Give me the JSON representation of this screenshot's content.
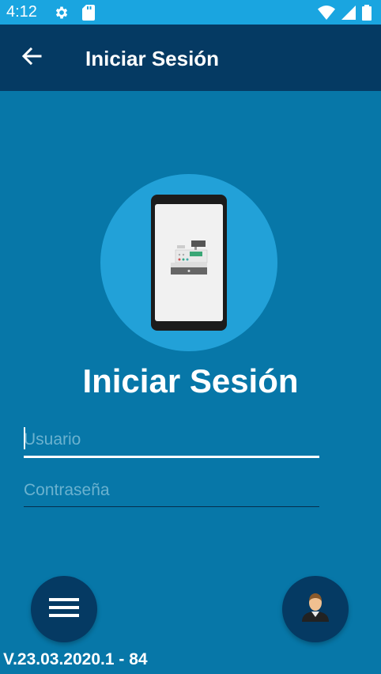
{
  "status_bar": {
    "time": "4:12",
    "icons": [
      "gear-icon",
      "sd-card-icon",
      "wifi-icon",
      "signal-icon",
      "battery-icon"
    ]
  },
  "app_bar": {
    "back_icon": "arrow-left-icon",
    "title": "Iniciar Sesión"
  },
  "hero": {
    "icon": "phone-cash-register-illustration"
  },
  "login": {
    "heading": "Iniciar Sesión",
    "username_placeholder": "Usuario",
    "username_value": "",
    "password_placeholder": "Contraseña",
    "password_value": ""
  },
  "fabs": {
    "menu_icon": "hamburger-menu-icon",
    "user_icon": "user-avatar-icon"
  },
  "footer": {
    "version": "V.23.03.2020.1 - 84"
  },
  "colors": {
    "background": "#0777a8",
    "status_bar": "#1aa5e0",
    "app_bar": "#053a63",
    "hero_circle": "#22a1d8",
    "fab": "#053a63"
  }
}
